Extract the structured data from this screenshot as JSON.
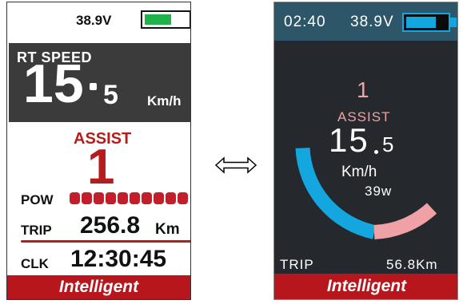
{
  "left_display": {
    "voltage": "38.9V",
    "battery_level": 0.6,
    "battery_color": "#1db34a",
    "speed_label": "RT SPEED",
    "speed_integer": "15",
    "speed_fraction": "5",
    "speed_unit": "Km/h",
    "assist_label": "ASSIST",
    "assist_level": "1",
    "power_label": "POW",
    "power_segments": 10,
    "trip_label": "TRIP",
    "trip_value": "256.8",
    "trip_unit": "Km",
    "clock_label": "CLK",
    "clock_value": "12:30:45",
    "footer": "Intelligent"
  },
  "right_display": {
    "time": "02:40",
    "voltage": "38.9V",
    "battery_level": 0.72,
    "battery_color": "#14a7df",
    "assist_level": "1",
    "assist_label": "ASSIST",
    "speed_integer": "15",
    "speed_fraction": "5",
    "speed_unit": "Km/h",
    "power": "39w",
    "gauge_colors": {
      "speed_arc": "#14a7df",
      "power_arc": "#f0a1a5"
    },
    "trip_label": "TRIP",
    "trip_value": "56.8Km",
    "footer": "Intelligent"
  },
  "colors": {
    "brand_red": "#b7161d",
    "assist_red": "#b51d1d",
    "pow_red": "#c21f2a"
  },
  "icons": {
    "swap": "double-arrow-icon"
  }
}
